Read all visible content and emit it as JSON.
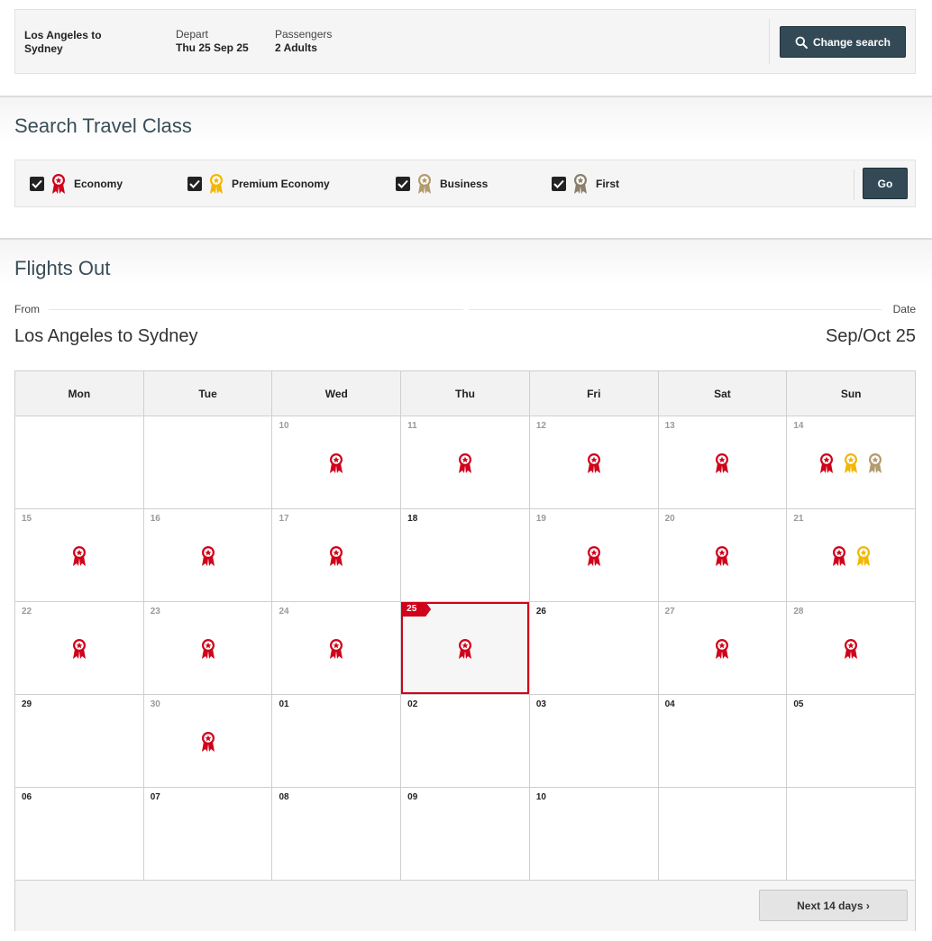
{
  "summary": {
    "route": "Los Angeles  to\nSydney",
    "depart_label": "Depart",
    "depart_value": "Thu 25 Sep 25",
    "passengers_label": "Passengers",
    "passengers_value": "2 Adults",
    "change_search_label": "Change search",
    "change_search_icon": "search-icon",
    "button_color": "#334a56"
  },
  "travel_class": {
    "title": "Search Travel Class",
    "classes": [
      {
        "label": "Economy",
        "checked": true,
        "color": "#d0021b"
      },
      {
        "label": "Premium Economy",
        "checked": true,
        "color": "#f2b705"
      },
      {
        "label": "Business",
        "checked": true,
        "color": "#b29b6c"
      },
      {
        "label": "First",
        "checked": true,
        "color": "#8a7f6b"
      }
    ],
    "go_label": "Go"
  },
  "flights_out": {
    "title": "Flights Out",
    "from_label": "From",
    "date_label": "Date",
    "route": "Los Angeles to Sydney",
    "month": "Sep/Oct 25",
    "weekdays": [
      "Mon",
      "Tue",
      "Wed",
      "Thu",
      "Fri",
      "Sat",
      "Sun"
    ],
    "weeks": [
      [
        {
          "num": "",
          "past": false,
          "awards": []
        },
        {
          "num": "",
          "past": false,
          "awards": []
        },
        {
          "num": "10",
          "past": true,
          "awards": [
            "economy"
          ]
        },
        {
          "num": "11",
          "past": true,
          "awards": [
            "economy"
          ]
        },
        {
          "num": "12",
          "past": true,
          "awards": [
            "economy"
          ]
        },
        {
          "num": "13",
          "past": true,
          "awards": [
            "economy"
          ]
        },
        {
          "num": "14",
          "past": true,
          "awards": [
            "economy",
            "premium",
            "business"
          ]
        }
      ],
      [
        {
          "num": "15",
          "past": true,
          "awards": [
            "economy"
          ]
        },
        {
          "num": "16",
          "past": true,
          "awards": [
            "economy"
          ]
        },
        {
          "num": "17",
          "past": true,
          "awards": [
            "economy"
          ]
        },
        {
          "num": "18",
          "past": false,
          "awards": []
        },
        {
          "num": "19",
          "past": true,
          "awards": [
            "economy"
          ]
        },
        {
          "num": "20",
          "past": true,
          "awards": [
            "economy"
          ]
        },
        {
          "num": "21",
          "past": true,
          "awards": [
            "economy",
            "premium"
          ]
        }
      ],
      [
        {
          "num": "22",
          "past": true,
          "awards": [
            "economy"
          ]
        },
        {
          "num": "23",
          "past": true,
          "awards": [
            "economy"
          ]
        },
        {
          "num": "24",
          "past": true,
          "awards": [
            "economy"
          ]
        },
        {
          "num": "25",
          "past": false,
          "selected": true,
          "awards": [
            "economy"
          ]
        },
        {
          "num": "26",
          "past": false,
          "awards": []
        },
        {
          "num": "27",
          "past": true,
          "awards": [
            "economy"
          ]
        },
        {
          "num": "28",
          "past": true,
          "awards": [
            "economy"
          ]
        }
      ],
      [
        {
          "num": "29",
          "past": false,
          "awards": []
        },
        {
          "num": "30",
          "past": true,
          "awards": [
            "economy"
          ]
        },
        {
          "num": "01",
          "past": false,
          "awards": []
        },
        {
          "num": "02",
          "past": false,
          "awards": []
        },
        {
          "num": "03",
          "past": false,
          "awards": []
        },
        {
          "num": "04",
          "past": false,
          "awards": []
        },
        {
          "num": "05",
          "past": false,
          "awards": []
        }
      ],
      [
        {
          "num": "06",
          "past": false,
          "awards": []
        },
        {
          "num": "07",
          "past": false,
          "awards": []
        },
        {
          "num": "08",
          "past": false,
          "awards": []
        },
        {
          "num": "09",
          "past": false,
          "awards": []
        },
        {
          "num": "10",
          "past": false,
          "awards": []
        },
        {
          "num": "",
          "past": false,
          "awards": []
        },
        {
          "num": "",
          "past": false,
          "awards": []
        }
      ]
    ],
    "award_icon": "award-ribbon-icon",
    "next_label": "Next 14 days ›",
    "selected_color": "#d0021b"
  }
}
